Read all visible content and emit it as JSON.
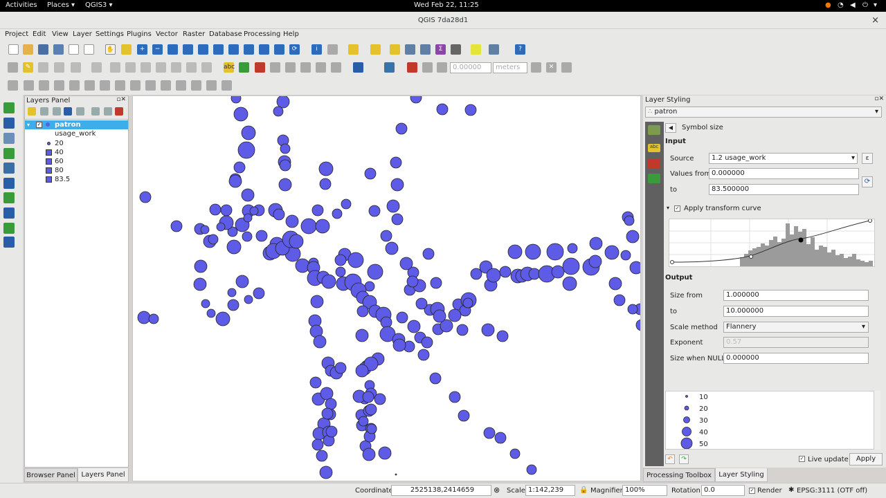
{
  "system_bar": {
    "activities": "Activities",
    "places": "Places ▾",
    "app": "QGIS3 ▾",
    "clock": "Wed Feb 22, 11:25"
  },
  "window": {
    "title": "QGIS 7da28d1",
    "close": "×"
  },
  "menu": [
    "Project",
    "Edit",
    "View",
    "Layer",
    "Settings",
    "Plugins",
    "Vector",
    "Raster",
    "Database",
    "Processing",
    "Help"
  ],
  "toolbar": {
    "snap_value": "0.00000",
    "units": "meters"
  },
  "layers_panel": {
    "title": "Layers Panel",
    "layer_name": "patron",
    "field": "usage_work",
    "legend": [
      "20",
      "40",
      "60",
      "80",
      "83.5"
    ]
  },
  "panel_tabs": {
    "browser": "Browser Panel",
    "layers": "Layers Panel"
  },
  "styling": {
    "title": "Layer Styling",
    "layer": "patron",
    "section": "Symbol size",
    "input": "Input",
    "source_label": "Source",
    "source": "1.2 usage_work",
    "values_from_label": "Values from",
    "values_from": "0.000000",
    "to_label": "to",
    "values_to": "83.500000",
    "apply_curve": "Apply transform curve",
    "output": "Output",
    "size_from_label": "Size from",
    "size_from": "1.000000",
    "size_to_label": "to",
    "size_to": "10.000000",
    "scale_method_label": "Scale method",
    "scale_method": "Flannery",
    "exponent_label": "Exponent",
    "exponent": "0.57",
    "null_label": "Size when NULL",
    "null_size": "0.000000",
    "preview": [
      "10",
      "20",
      "30",
      "40",
      "50"
    ],
    "live_update": "Live update",
    "apply": "Apply"
  },
  "styling_tabs": {
    "toolbox": "Processing Toolbox",
    "styling": "Layer Styling"
  },
  "status": {
    "coordinate_label": "Coordinate",
    "coordinate": "2525138,2414659",
    "scale_label": "Scale",
    "scale": "1:142,239",
    "magnifier_label": "Magnifier",
    "magnifier": "100%",
    "rotation_label": "Rotation",
    "rotation": "0.0",
    "render": "Render",
    "crs": "EPSG:3111 (OTF off)"
  },
  "colors": {
    "point_fill": "#5e5ce6",
    "selection": "#3daee9",
    "histogram": "#9b9b9b"
  }
}
